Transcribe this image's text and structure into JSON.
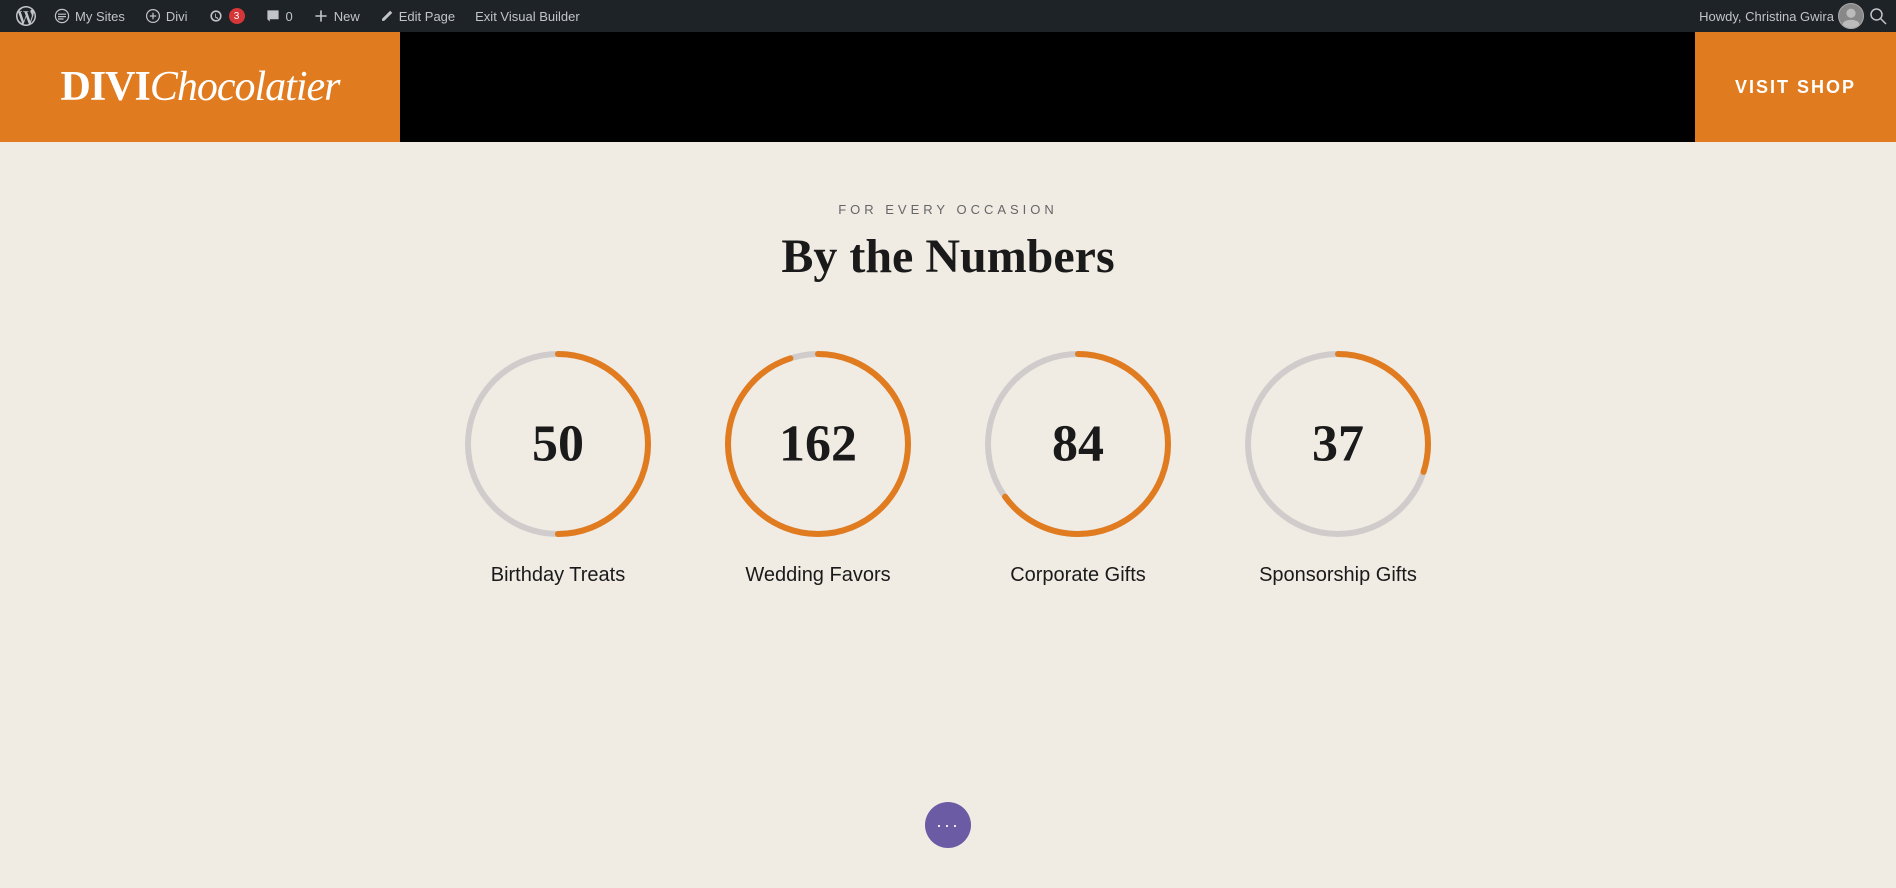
{
  "adminBar": {
    "wpLogo": "⊕",
    "mySitesLabel": "My Sites",
    "diviLabel": "Divi",
    "updatesCount": "3",
    "commentsCount": "0",
    "newLabel": "New",
    "editPageLabel": "Edit Page",
    "exitBuilderLabel": "Exit Visual Builder",
    "userGreeting": "Howdy, Christina Gwira"
  },
  "header": {
    "logoMain": "DIVI",
    "logoScript": "Chocolatier",
    "visitShopLabel": "VISIT SHOP"
  },
  "section": {
    "subtitle": "FOR EVERY OCCASION",
    "title": "By the Numbers"
  },
  "stats": [
    {
      "value": "50",
      "label": "Birthday Treats",
      "percent": 50,
      "circumference": 565.48
    },
    {
      "value": "162",
      "label": "Wedding Favors",
      "percent": 95,
      "circumference": 565.48
    },
    {
      "value": "84",
      "label": "Corporate Gifts",
      "percent": 65,
      "circumference": 565.48
    },
    {
      "value": "37",
      "label": "Sponsorship Gifts",
      "percent": 30,
      "circumference": 565.48
    }
  ],
  "diviBtn": {
    "label": "···"
  },
  "colors": {
    "orange": "#e07b20",
    "adminBg": "#1d2327",
    "purple": "#6b5ba5"
  }
}
